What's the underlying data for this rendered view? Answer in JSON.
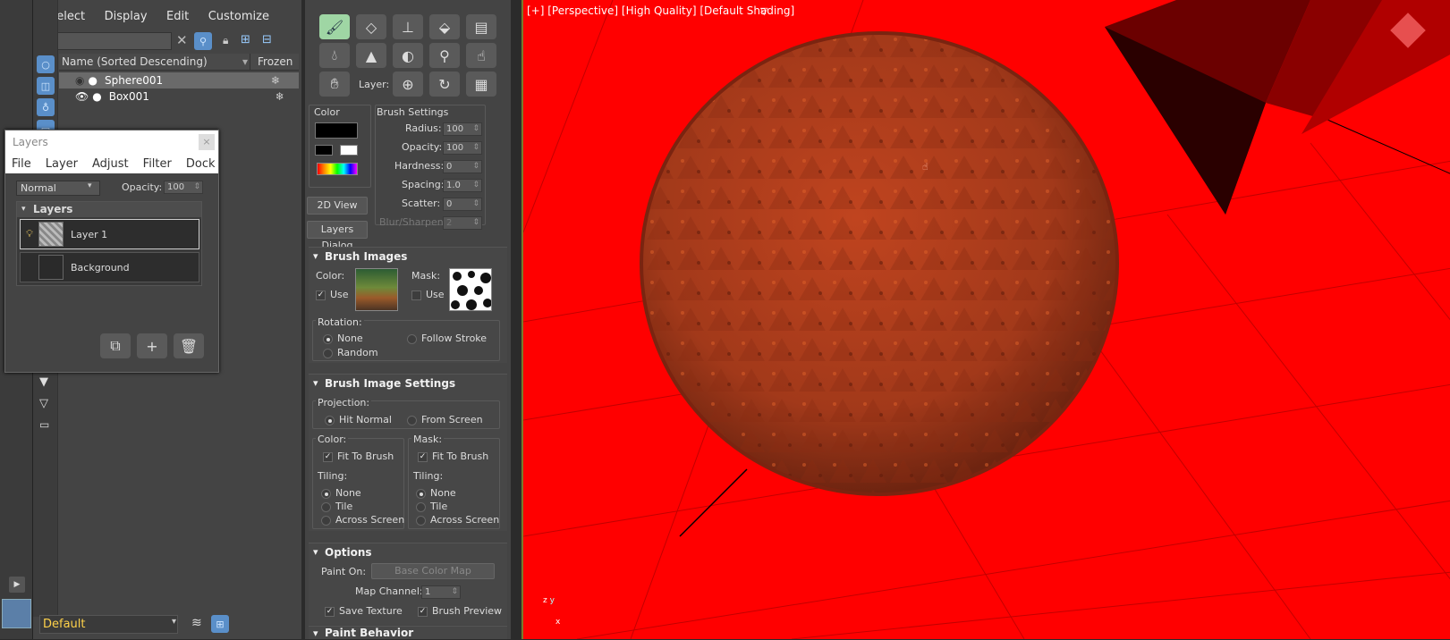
{
  "scene_explorer": {
    "menu": [
      "Select",
      "Display",
      "Edit",
      "Customize"
    ],
    "columns": {
      "name": "Name (Sorted Descending)",
      "frozen": "Frozen"
    },
    "objects": [
      {
        "name": "Sphere001",
        "selected": true
      },
      {
        "name": "Box001",
        "selected": false
      }
    ],
    "layer_field": "Default"
  },
  "layers_dialog": {
    "title": "Layers",
    "menu": [
      "File",
      "Layer",
      "Adjust",
      "Filter",
      "Dock"
    ],
    "blend_mode": "Normal",
    "opacity_label": "Opacity:",
    "opacity_value": "100",
    "section": "Layers",
    "layers": [
      {
        "name": "Layer 1",
        "active": true
      },
      {
        "name": "Background",
        "active": false
      }
    ]
  },
  "paint_panel": {
    "layer_label": "Layer:",
    "color_group": "Color",
    "brush_settings": {
      "title": "Brush Settings",
      "radius_label": "Radius:",
      "radius": "100",
      "opacity_label": "Opacity:",
      "opacity": "100",
      "hardness_label": "Hardness:",
      "hardness": "0",
      "spacing_label": "Spacing:",
      "spacing": "1.0",
      "scatter_label": "Scatter:",
      "scatter": "0",
      "blur_label": "Blur/Sharpen:",
      "blur": "2"
    },
    "view2d_button": "2D View",
    "layers_dialog_button": "Layers Dialog",
    "brush_images": {
      "title": "Brush Images",
      "color_label": "Color:",
      "use_label": "Use",
      "mask_label": "Mask:",
      "mask_use_label": "Use",
      "rotation_label": "Rotation:",
      "rot_none": "None",
      "rot_follow": "Follow Stroke",
      "rot_random": "Random"
    },
    "brush_image_settings": {
      "title": "Brush Image Settings",
      "projection_label": "Projection:",
      "hit_normal": "Hit Normal",
      "from_screen": "From Screen",
      "color_label": "Color:",
      "mask_label": "Mask:",
      "fit_to_brush": "Fit To Brush",
      "tiling_label": "Tiling:",
      "tiling_none": "None",
      "tiling_tile": "Tile",
      "tiling_across": "Across Screen"
    },
    "options": {
      "title": "Options",
      "paint_on_label": "Paint On:",
      "paint_on_value": "Base Color Map",
      "map_channel_label": "Map Channel:",
      "map_channel_value": "1",
      "save_texture": "Save Texture",
      "brush_preview": "Brush Preview"
    },
    "paint_behavior": {
      "title": "Paint Behavior"
    }
  },
  "viewport": {
    "label": "[+] [Perspective] [High Quality] [Default Shading]",
    "background_color": "#ff0000",
    "axis_labels": {
      "z": "z",
      "y": "y",
      "x": "x"
    }
  }
}
